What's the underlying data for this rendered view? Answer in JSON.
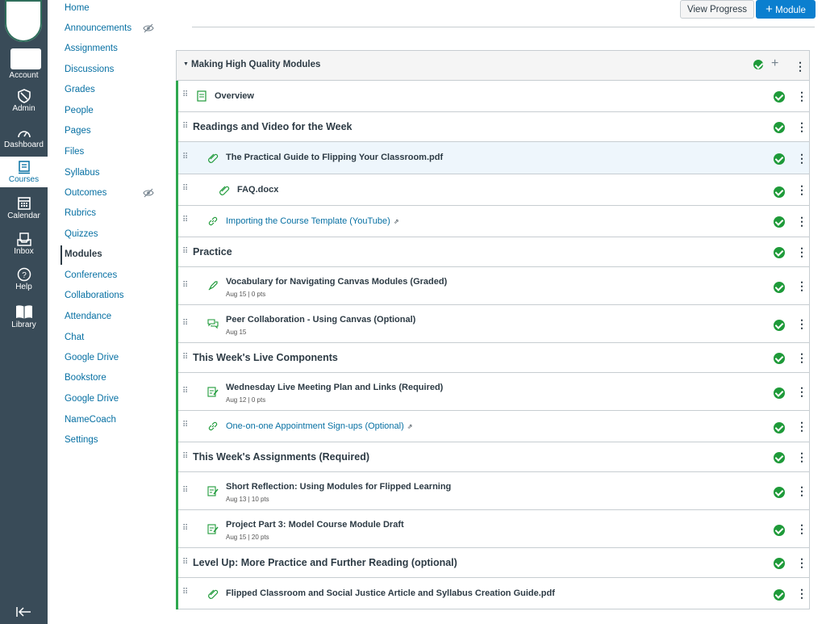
{
  "global_nav": {
    "items": [
      {
        "label": "Account",
        "icon": "account-icon"
      },
      {
        "label": "Admin",
        "icon": "admin-icon"
      },
      {
        "label": "Dashboard",
        "icon": "dashboard-icon"
      },
      {
        "label": "Courses",
        "icon": "courses-icon",
        "active": true
      },
      {
        "label": "Calendar",
        "icon": "calendar-icon"
      },
      {
        "label": "Inbox",
        "icon": "inbox-icon"
      },
      {
        "label": "Help",
        "icon": "help-icon"
      },
      {
        "label": "Library",
        "icon": "library-icon"
      }
    ],
    "collapse_icon": "collapse-arrow-icon"
  },
  "course_nav": {
    "items": [
      {
        "label": "Home"
      },
      {
        "label": "Announcements",
        "hidden": true
      },
      {
        "label": "Assignments"
      },
      {
        "label": "Discussions"
      },
      {
        "label": "Grades"
      },
      {
        "label": "People"
      },
      {
        "label": "Pages"
      },
      {
        "label": "Files"
      },
      {
        "label": "Syllabus"
      },
      {
        "label": "Outcomes",
        "hidden": true
      },
      {
        "label": "Rubrics"
      },
      {
        "label": "Quizzes"
      },
      {
        "label": "Modules",
        "active": true
      },
      {
        "label": "Conferences"
      },
      {
        "label": "Collaborations"
      },
      {
        "label": "Attendance"
      },
      {
        "label": "Chat"
      },
      {
        "label": "Google Drive"
      },
      {
        "label": "Bookstore"
      },
      {
        "label": "Google Drive"
      },
      {
        "label": "NameCoach"
      },
      {
        "label": "Settings"
      }
    ]
  },
  "header": {
    "view_progress_label": "View Progress",
    "add_module_label": "Module",
    "add_module_plus": "+"
  },
  "module": {
    "title": "Making High Quality Modules",
    "items": [
      {
        "kind": "page",
        "title": "Overview",
        "indent": 0
      },
      {
        "kind": "subheader",
        "title": "Readings and Video for the Week"
      },
      {
        "kind": "file",
        "title": "The Practical Guide to Flipping Your Classroom.pdf",
        "indent": 1
      },
      {
        "kind": "file",
        "title": "FAQ.docx",
        "indent": 2
      },
      {
        "kind": "link",
        "title": "Importing the Course Template (YouTube)",
        "indent": 1
      },
      {
        "kind": "subheader",
        "title": "Practice"
      },
      {
        "kind": "quiz",
        "title": "Vocabulary for Navigating Canvas Modules (Graded)",
        "meta": "Aug 15  |  0 pts",
        "indent": 1
      },
      {
        "kind": "discussion",
        "title": "Peer Collaboration - Using Canvas (Optional)",
        "meta": "Aug 15",
        "indent": 1
      },
      {
        "kind": "subheader",
        "title": "This Week's Live Components"
      },
      {
        "kind": "assignment",
        "title": "Wednesday Live Meeting Plan and Links (Required)",
        "meta": "Aug 12  |  0 pts",
        "indent": 1
      },
      {
        "kind": "link",
        "title": "One-on-one Appointment Sign-ups (Optional)",
        "indent": 1
      },
      {
        "kind": "subheader",
        "title": "This Week's Assignments (Required)"
      },
      {
        "kind": "assignment",
        "title": "Short Reflection: Using Modules for Flipped Learning",
        "meta": "Aug 13  |  10 pts",
        "indent": 1
      },
      {
        "kind": "assignment",
        "title": "Project Part 3: Model Course Module Draft",
        "meta": "Aug 15  |  20 pts",
        "indent": 1
      },
      {
        "kind": "subheader",
        "title": "Level Up: More Practice and Further Reading (optional)"
      },
      {
        "kind": "file",
        "title": "Flipped Classroom and Social Justice Article and Syllabus Creation Guide.pdf",
        "indent": 1
      }
    ]
  },
  "colors": {
    "nav_bg": "#394b58",
    "link": "#0770a3",
    "primary_button": "#0b7fcf",
    "success": "#1e9a39",
    "module_border": "#2fa84f"
  }
}
